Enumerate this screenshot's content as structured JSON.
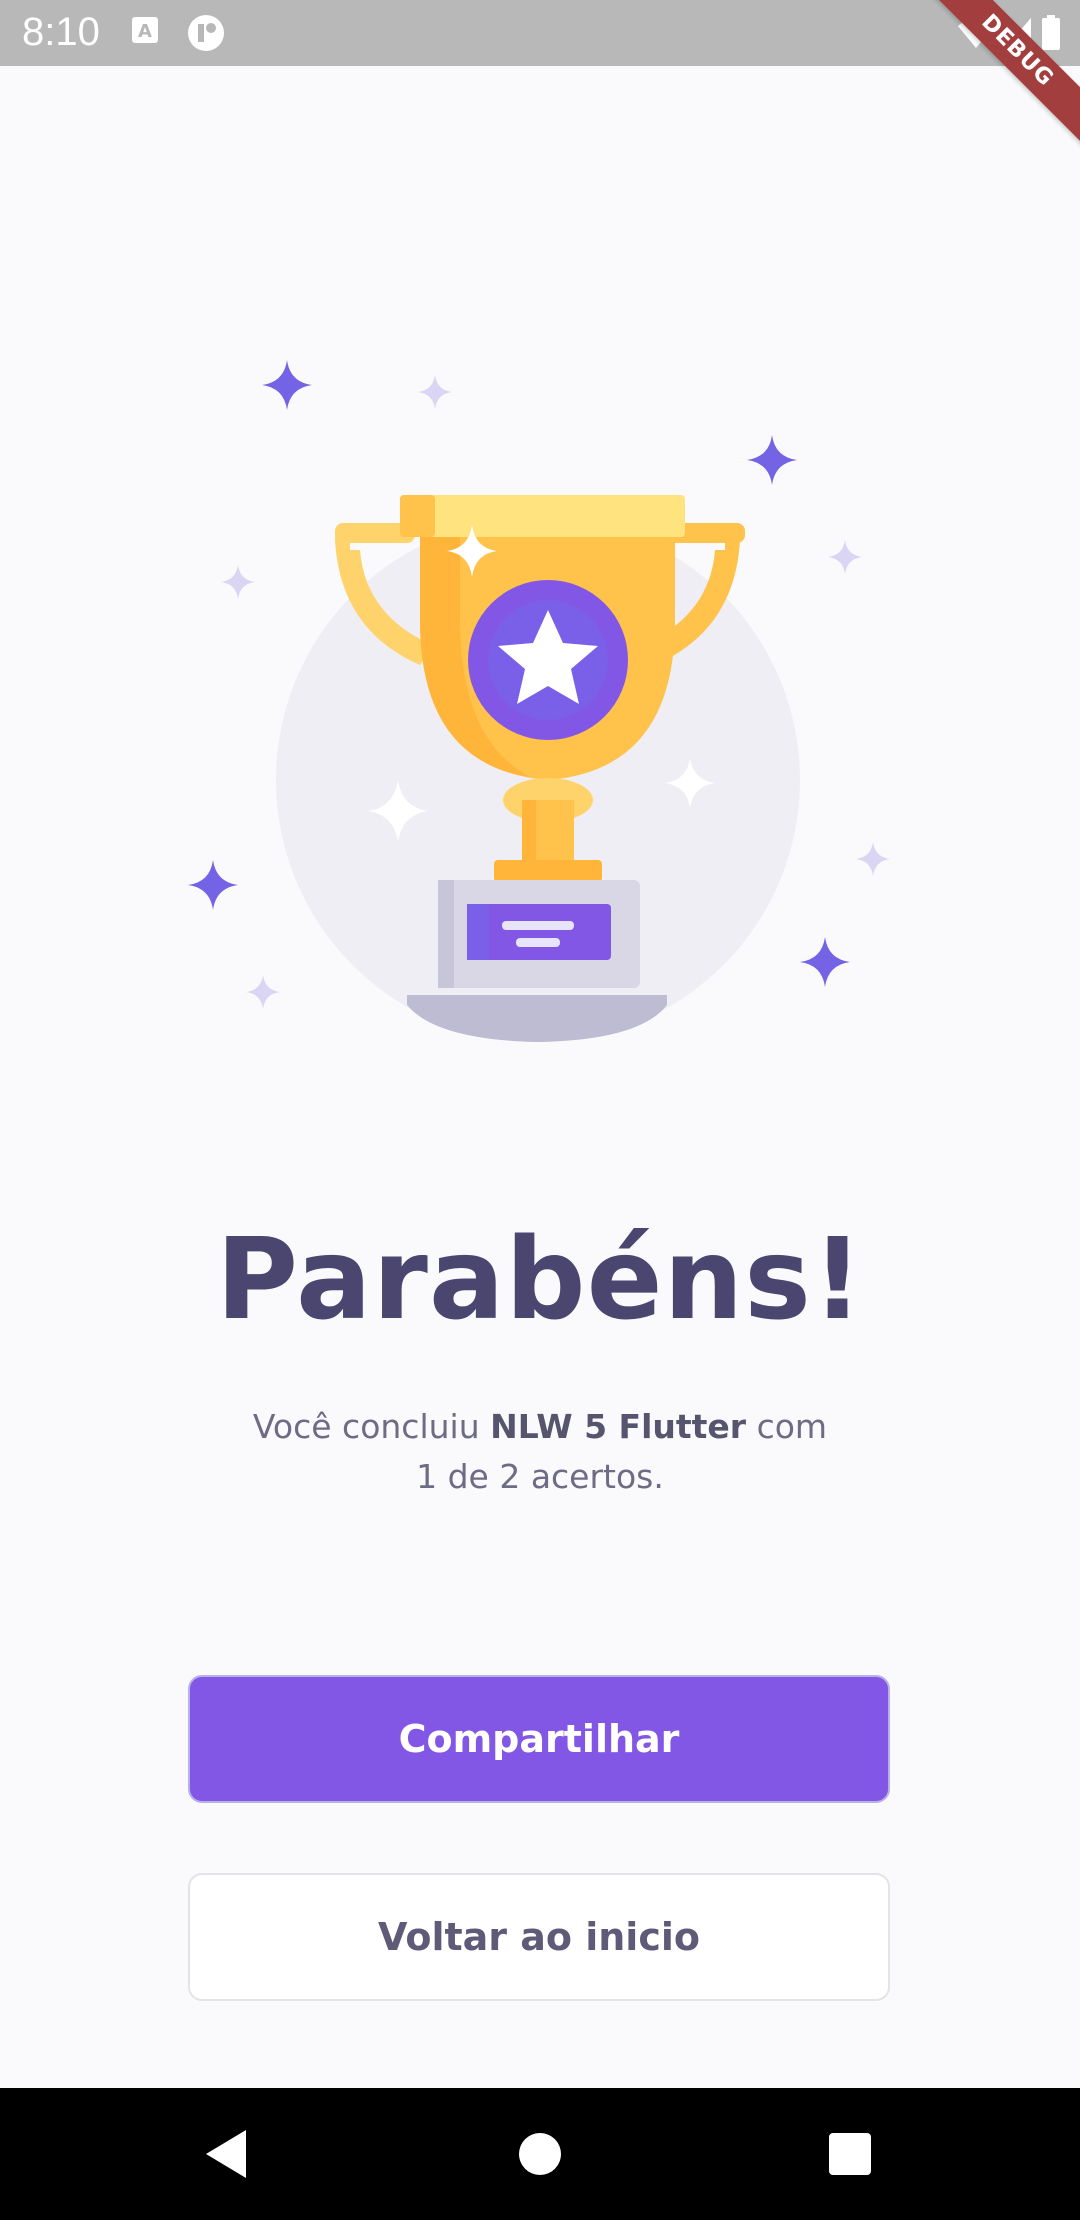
{
  "status_bar": {
    "time": "8:10",
    "icons": [
      "a-notification-icon",
      "app-notification-icon",
      "wifi-icon",
      "signal-icon",
      "battery-icon"
    ],
    "debug_label": "DEBUG",
    "background": "#B8B8B8"
  },
  "illustration": {
    "name": "trophy-with-star",
    "colors": {
      "gold": "#FFC24B",
      "purple": "#8257E5",
      "sparkle": "#7563E6"
    }
  },
  "result": {
    "title": "Parabéns!",
    "message_prefix": "Você concluiu ",
    "quiz_name": "NLW 5 Flutter",
    "message_mid": " com",
    "score_text": "1 de 2 acertos."
  },
  "actions": {
    "share_label": "Compartilhar",
    "back_label": "Voltar ao inicio",
    "share_color": "#8257E5"
  },
  "nav_bar": {
    "icons": [
      "back-triangle-icon",
      "home-circle-icon",
      "recents-square-icon"
    ]
  }
}
